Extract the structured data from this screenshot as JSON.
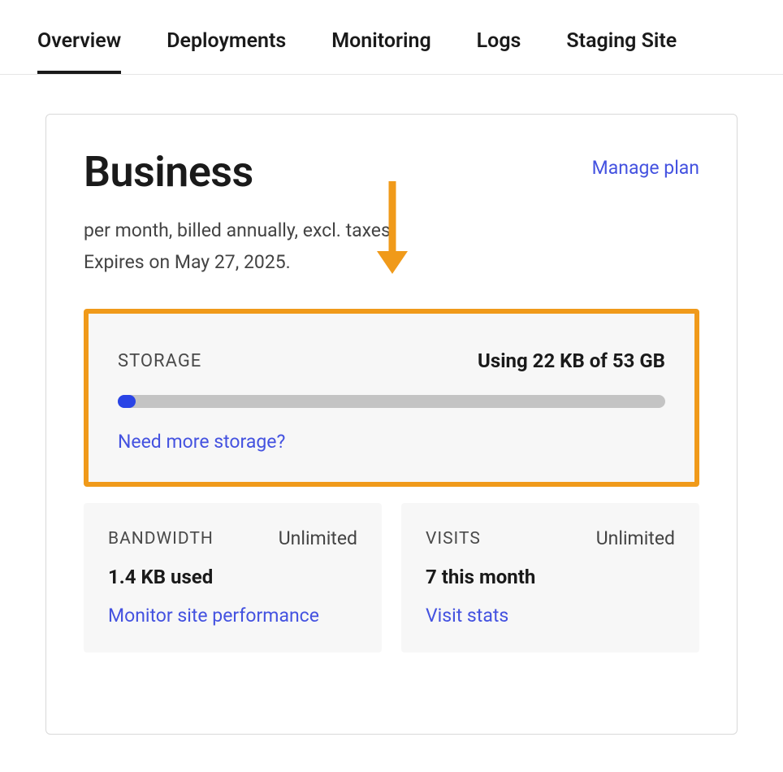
{
  "tabs": {
    "overview": "Overview",
    "deployments": "Deployments",
    "monitoring": "Monitoring",
    "logs": "Logs",
    "staging": "Staging Site"
  },
  "plan": {
    "title": "Business",
    "manage_link": "Manage plan",
    "meta_line1": "per month, billed annually, excl. taxes.",
    "meta_line2": "Expires on May 27, 2025."
  },
  "storage": {
    "label": "STORAGE",
    "usage": "Using 22 KB of 53 GB",
    "link": "Need more storage?"
  },
  "bandwidth": {
    "label": "BANDWIDTH",
    "limit": "Unlimited",
    "value": "1.4 KB used",
    "link": "Monitor site performance"
  },
  "visits": {
    "label": "VISITS",
    "limit": "Unlimited",
    "value": "7 this month",
    "link": "Visit stats"
  },
  "annotation": {
    "arrow_color": "#f09a1a"
  }
}
